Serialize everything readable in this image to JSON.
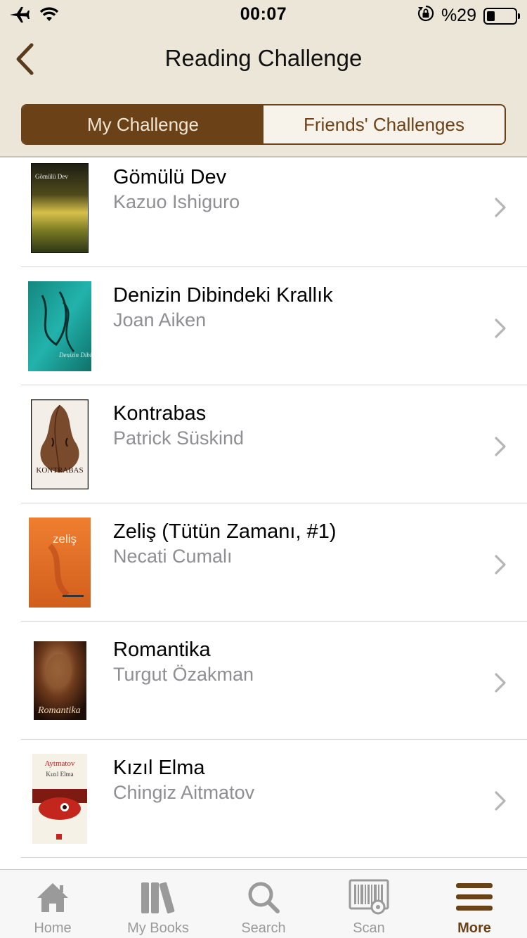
{
  "status_bar": {
    "time": "00:07",
    "battery_text": "%29",
    "battery_level": 0.29,
    "icons": [
      "airplane-icon",
      "wifi-icon",
      "orientation-lock-icon",
      "battery-icon"
    ]
  },
  "nav": {
    "title": "Reading Challenge",
    "back_icon": "chevron-left-icon"
  },
  "segmented": {
    "my_challenge": "My Challenge",
    "friends_challenges": "Friends' Challenges",
    "selected": "my_challenge"
  },
  "books": [
    {
      "title": "Gömülü Dev",
      "author": "Kazuo Ishiguro",
      "cover_text": "Gömülü Dev",
      "cover_colors": [
        "#1e2a16",
        "#c9b23a"
      ]
    },
    {
      "title": "Denizin Dibindeki Krallık",
      "author": "Joan Aiken",
      "cover_text": "Denizin Dibindeki Krallık",
      "cover_colors": [
        "#1aa3a0",
        "#0f6f6a"
      ]
    },
    {
      "title": "Kontrabas",
      "author": "Patrick Süskind",
      "cover_text": "KONTRABAS",
      "cover_colors": [
        "#8a5a3a",
        "#5a3620"
      ]
    },
    {
      "title": "Zeliş (Tütün Zamanı, #1)",
      "author": "Necati Cumalı",
      "cover_text": "zeliş",
      "cover_colors": [
        "#e8772d",
        "#c95a1a"
      ]
    },
    {
      "title": "Romantika",
      "author": "Turgut Özakman",
      "cover_text": "Romantika",
      "cover_colors": [
        "#3a1a10",
        "#a0622e"
      ]
    },
    {
      "title": "Kızıl Elma",
      "author": "Chingiz Aitmatov",
      "cover_text": "Kızıl Elma",
      "cover_colors": [
        "#f4efe4",
        "#c3261d"
      ]
    }
  ],
  "tabs": [
    {
      "label": "Home",
      "icon": "home-icon",
      "active": false
    },
    {
      "label": "My Books",
      "icon": "books-icon",
      "active": false
    },
    {
      "label": "Search",
      "icon": "search-icon",
      "active": false
    },
    {
      "label": "Scan",
      "icon": "barcode-scan-icon",
      "active": false
    },
    {
      "label": "More",
      "icon": "menu-icon",
      "active": true
    }
  ],
  "colors": {
    "accent": "#6b4117",
    "header_bg": "#ebe6d8",
    "author_gray": "#8e8e93"
  }
}
